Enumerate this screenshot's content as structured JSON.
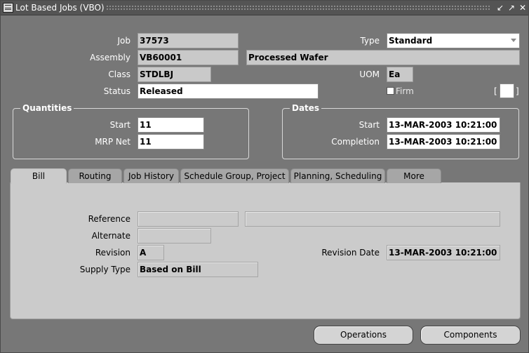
{
  "window": {
    "title": "Lot Based Jobs (VBO)"
  },
  "header": {
    "job_label": "Job",
    "job_value": "37573",
    "assembly_label": "Assembly",
    "assembly_value": "VB60001",
    "assembly_desc": "Processed Wafer",
    "class_label": "Class",
    "class_value": "STDLBJ",
    "status_label": "Status",
    "status_value": "Released",
    "type_label": "Type",
    "type_value": "Standard",
    "uom_label": "UOM",
    "uom_value": "Ea",
    "firm_label": "Firm",
    "firm_checked": false
  },
  "quantities": {
    "title": "Quantities",
    "start_label": "Start",
    "start_value": "11",
    "mrp_label": "MRP Net",
    "mrp_value": "11"
  },
  "dates": {
    "title": "Dates",
    "start_label": "Start",
    "start_value": "13-MAR-2003 10:21:00",
    "completion_label": "Completion",
    "completion_value": "13-MAR-2003 10:21:00"
  },
  "tabs": [
    {
      "label": "Bill",
      "active": true
    },
    {
      "label": "Routing"
    },
    {
      "label": "Job History"
    },
    {
      "label": "Schedule Group, Project"
    },
    {
      "label": "Planning, Scheduling"
    },
    {
      "label": "More"
    }
  ],
  "bill": {
    "reference_label": "Reference",
    "reference_value": "",
    "reference_desc": "",
    "alternate_label": "Alternate",
    "alternate_value": "",
    "revision_label": "Revision",
    "revision_value": "A",
    "revision_date_label": "Revision Date",
    "revision_date_value": "13-MAR-2003 10:21:00",
    "supply_type_label": "Supply Type",
    "supply_type_value": "Based on Bill"
  },
  "buttons": {
    "operations": "Operations",
    "components": "Components"
  },
  "colors": {
    "window_bg": "#777777",
    "panel_bg": "#cbcbcb",
    "field_bg": "#c9c9c9"
  }
}
